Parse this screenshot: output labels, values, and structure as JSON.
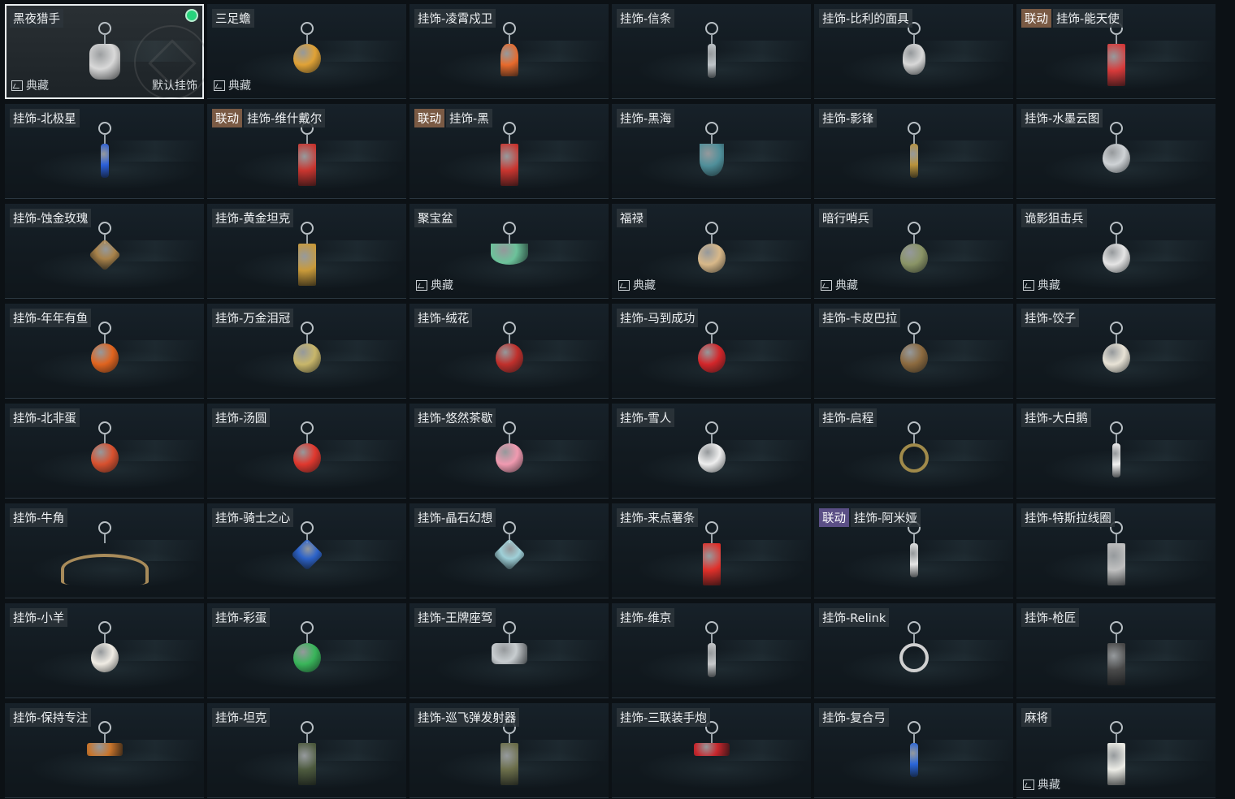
{
  "accent": {
    "selected_border": "#e9eef0",
    "equipped_dot": "#28d37c",
    "collab_brown": "#7a5a44",
    "collab_purple": "#5b4f86"
  },
  "common": {
    "collection_label": "典藏",
    "default_label": "默认挂饰"
  },
  "items": [
    {
      "name": "黑夜猎手",
      "collection": true,
      "selected": true,
      "equipped": true,
      "default": true,
      "color": "#d9d9d9",
      "shape": "figure"
    },
    {
      "name": "三足蟾",
      "collection": true,
      "color": "#e0a236",
      "shape": "round"
    },
    {
      "name": "挂饰-凌霄戍卫",
      "color": "#e76a2c",
      "shape": "rocket"
    },
    {
      "name": "挂饰-信条",
      "color": "#bfc5c9",
      "shape": "slim"
    },
    {
      "name": "挂饰-比利的面具",
      "color": "#d8d8d8",
      "shape": "mask"
    },
    {
      "name": "挂饰-能天使",
      "collab": "联动",
      "collab_color": "brown",
      "color": "#d73a3a",
      "shape": "tag"
    },
    {
      "name": "挂饰-北极星",
      "color": "#2b5fd9",
      "shape": "slim"
    },
    {
      "name": "挂饰-维什戴尔",
      "collab": "联动",
      "collab_color": "brown",
      "color": "#c9352f",
      "shape": "tag"
    },
    {
      "name": "挂饰-黑",
      "collab": "联动",
      "collab_color": "brown",
      "color": "#c9352f",
      "shape": "tag"
    },
    {
      "name": "挂饰-黑海",
      "color": "#4f8f9a",
      "shape": "anchor"
    },
    {
      "name": "挂饰-影锋",
      "color": "#b8923c",
      "shape": "slim"
    },
    {
      "name": "挂饰-水墨云图",
      "color": "#cfd3d6",
      "shape": "round"
    },
    {
      "name": "挂饰-蚀金玫瑰",
      "color": "#a8824a",
      "shape": "diamond"
    },
    {
      "name": "挂饰-黄金坦克",
      "color": "#c99a3a",
      "shape": "tag"
    },
    {
      "name": "聚宝盆",
      "collection": true,
      "color": "#6cc29a",
      "shape": "bowl"
    },
    {
      "name": "福禄",
      "collection": true,
      "color": "#d8b889",
      "shape": "round"
    },
    {
      "name": "暗行哨兵",
      "collection": true,
      "color": "#8a9466",
      "shape": "round"
    },
    {
      "name": "诡影狙击兵",
      "collection": true,
      "color": "#e5e5e5",
      "shape": "round"
    },
    {
      "name": "挂饰-年年有鱼",
      "color": "#e0641f",
      "shape": "round"
    },
    {
      "name": "挂饰-万金泪冠",
      "color": "#c8b66a",
      "shape": "round"
    },
    {
      "name": "挂饰-绒花",
      "color": "#c0302c",
      "shape": "round"
    },
    {
      "name": "挂饰-马到成功",
      "color": "#d3262a",
      "shape": "round"
    },
    {
      "name": "挂饰-卡皮巴拉",
      "color": "#8c6a3f",
      "shape": "round"
    },
    {
      "name": "挂饰-饺子",
      "color": "#e8e3d6",
      "shape": "round"
    },
    {
      "name": "挂饰-北非蛋",
      "color": "#d8512f",
      "shape": "round"
    },
    {
      "name": "挂饰-汤圆",
      "color": "#e0382e",
      "shape": "round"
    },
    {
      "name": "挂饰-悠然茶歇",
      "color": "#f09ab0",
      "shape": "round"
    },
    {
      "name": "挂饰-雪人",
      "color": "#eeeeee",
      "shape": "round"
    },
    {
      "name": "挂饰-启程",
      "color": "#a08a4a",
      "shape": "ringbig"
    },
    {
      "name": "挂饰-大白鹅",
      "color": "#f2f2f2",
      "shape": "slim"
    },
    {
      "name": "挂饰-牛角",
      "color": "#a88b5a",
      "shape": "horns"
    },
    {
      "name": "挂饰-骑士之心",
      "color": "#2d63c9",
      "shape": "diamond"
    },
    {
      "name": "挂饰-晶石幻想",
      "color": "#9fd0d8",
      "shape": "diamond"
    },
    {
      "name": "挂饰-来点薯条",
      "color": "#e0302a",
      "shape": "tag"
    },
    {
      "name": "挂饰-阿米娅",
      "collab": "联动",
      "collab_color": "purple",
      "color": "#e5e5e5",
      "shape": "slim"
    },
    {
      "name": "挂饰-特斯拉线圈",
      "color": "#c0c0c0",
      "shape": "tag"
    },
    {
      "name": "挂饰-小羊",
      "color": "#f0ece4",
      "shape": "round"
    },
    {
      "name": "挂饰-彩蛋",
      "color": "#39b55a",
      "shape": "round"
    },
    {
      "name": "挂饰-王牌座驾",
      "color": "#c8cdd0",
      "shape": "plane"
    },
    {
      "name": "挂饰-维京",
      "color": "#c7c9cb",
      "shape": "slim"
    },
    {
      "name": "挂饰-Relink",
      "color": "#d0d0d0",
      "shape": "ringbig"
    },
    {
      "name": "挂饰-枪匠",
      "color": "#4a4a4a",
      "shape": "tag"
    },
    {
      "name": "挂饰-保持专注",
      "color": "#c8752c",
      "shape": "bar"
    },
    {
      "name": "挂饰-坦克",
      "color": "#4d5a3e",
      "shape": "tag"
    },
    {
      "name": "挂饰-巡飞弹发射器",
      "color": "#6b6e4a",
      "shape": "tag"
    },
    {
      "name": "挂饰-三联装手炮",
      "color": "#c8272d",
      "shape": "bar"
    },
    {
      "name": "挂饰-复合弓",
      "color": "#2a66d9",
      "shape": "slim"
    },
    {
      "name": "麻将",
      "collection": true,
      "color": "#ecece6",
      "shape": "tag"
    }
  ]
}
